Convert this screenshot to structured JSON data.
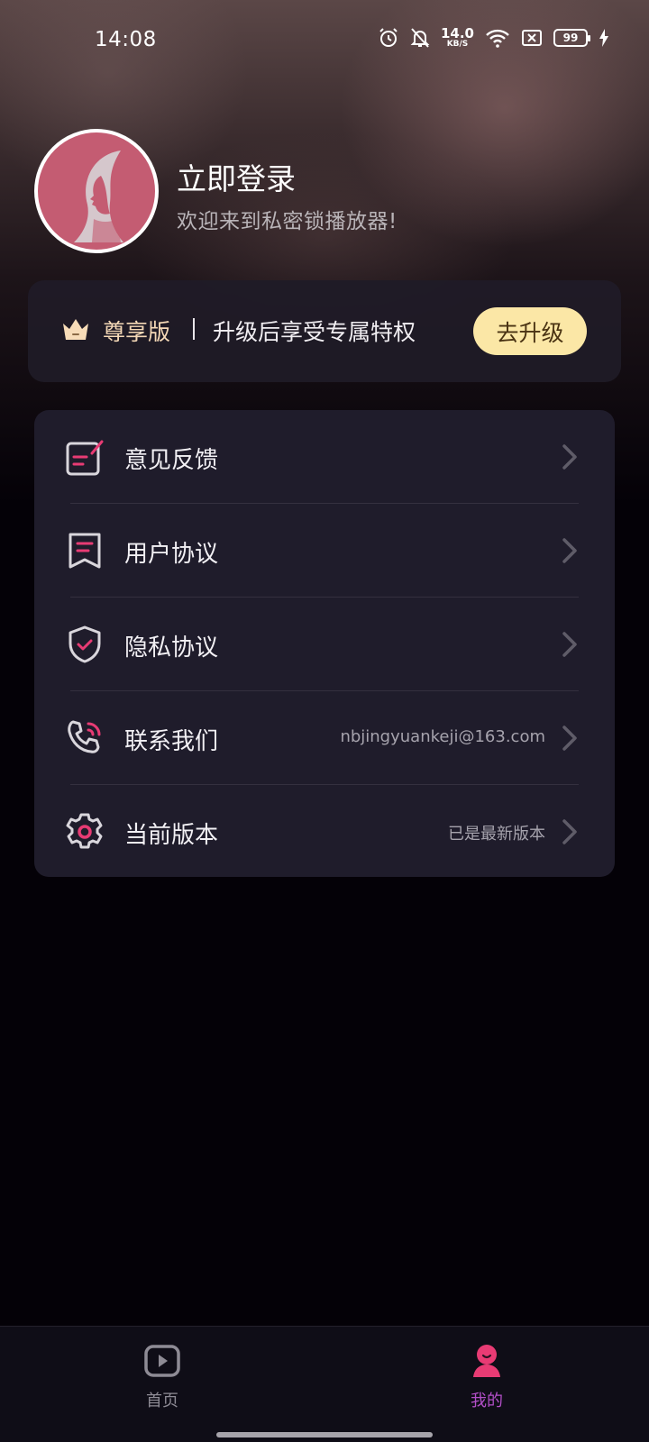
{
  "status_bar": {
    "time": "14:08",
    "net_speed_value": "14.0",
    "net_speed_unit": "KB/S",
    "battery": "99",
    "icons": [
      "alarm-icon",
      "bell-off-icon",
      "wifi-icon",
      "sim-off-icon",
      "battery-icon",
      "charging-icon"
    ]
  },
  "profile": {
    "title": "立即登录",
    "subtitle": "欢迎来到私密锁播放器!"
  },
  "vip": {
    "label": "尊享版",
    "separator": "|",
    "description": "升级后享受专属特权",
    "button_label": "去升级"
  },
  "menu": {
    "items": [
      {
        "label": "意见反馈",
        "value": "",
        "icon": "feedback-icon"
      },
      {
        "label": "用户协议",
        "value": "",
        "icon": "bookmark-doc-icon"
      },
      {
        "label": "隐私协议",
        "value": "",
        "icon": "shield-check-icon"
      },
      {
        "label": "联系我们",
        "value": "nbjingyuankeji@163.com",
        "icon": "phone-call-icon"
      },
      {
        "label": "当前版本",
        "value": "已是最新版本",
        "icon": "gear-icon"
      }
    ]
  },
  "bottom_nav": {
    "items": [
      {
        "label": "首页",
        "icon": "play-icon",
        "active": false
      },
      {
        "label": "我的",
        "icon": "profile-icon",
        "active": true
      }
    ]
  },
  "colors": {
    "accent_pink": "#e83b74",
    "active_tab": "#b34fc8",
    "vip_button_bg": "#fbe7a6",
    "vip_label": "#f5d9b7",
    "card_bg": "#1f1c2b"
  }
}
